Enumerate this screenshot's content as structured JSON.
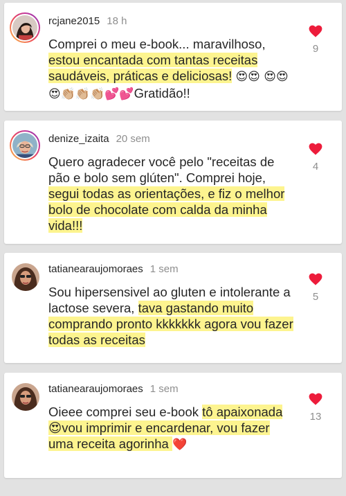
{
  "comments": [
    {
      "username": "rcjane2015",
      "time": "18 h",
      "likes": "9",
      "text_plain": "Comprei o meu e-book... maravilhoso, ",
      "text_highlight": "estou encantada com tantas receitas saudáveis, práticas e deliciosas!",
      "emoji_line": "😍😍 😍😍😍👏🏼👏🏼👏🏼💕💕",
      "text_tail": "Gratidão!!"
    },
    {
      "username": "denize_izaita",
      "time": "20 sem",
      "likes": "4",
      "text_plain": "Quero agradecer você pelo \"receitas de pão e bolo sem glúten\". Comprei hoje, ",
      "text_highlight": "segui todas as orientações, e fiz o melhor bolo de chocolate com calda da minha vida!!! "
    },
    {
      "username": "tatianearaujomoraes",
      "time": "1 sem",
      "likes": "5",
      "text_plain": "Sou hipersensivel ao gluten e intolerante a lactose severa, ",
      "text_highlight": "tava gastando muito comprando pronto kkkkkkk agora vou fazer todas as receitas "
    },
    {
      "username": "tatianearaujomoraes",
      "time": "1 sem",
      "likes": "13",
      "text_plain": "Oieee comprei seu e-book ",
      "text_highlight": "tô apaixonada 😍vou imprimir e encardenar, vou fazer uma receita agorinha ",
      "emoji_tail": "❤️"
    }
  ],
  "colors": {
    "highlight": "#fdf48f",
    "like_heart": "#ed1c3b",
    "secondary_text": "#8e8e8e"
  },
  "icons": {
    "like": "heart-icon",
    "avatar_ring": "story-ring"
  }
}
